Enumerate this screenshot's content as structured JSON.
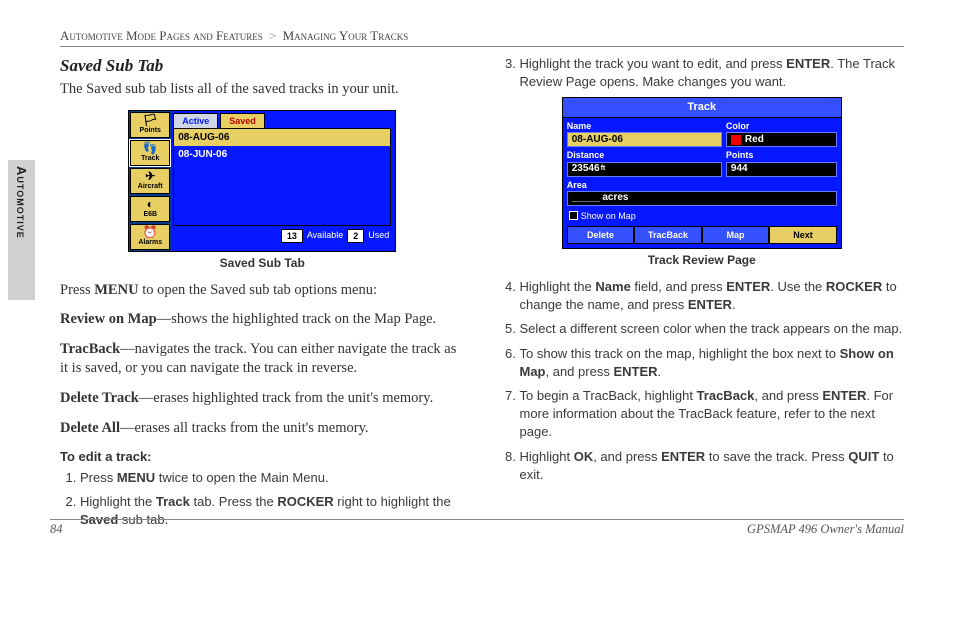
{
  "breadcrumb": {
    "section": "Automotive Mode Pages and Features",
    "sub": "Managing Your Tracks"
  },
  "side_tab": "Automotive",
  "left": {
    "heading": "Saved Sub Tab",
    "intro": "The Saved sub tab lists all of the saved tracks in your unit.",
    "figure_caption": "Saved Sub Tab",
    "after_fig": "Press MENU to open the Saved sub tab options menu:",
    "items": [
      {
        "term": "Review on Map",
        "desc": "—shows the highlighted track on the Map Page."
      },
      {
        "term": "TracBack",
        "desc": "—navigates the track. You can either navigate the track as it is saved, or you can navigate the track in reverse."
      },
      {
        "term": "Delete Track",
        "desc": "—erases highlighted track from the unit's memory."
      },
      {
        "term": "Delete All",
        "desc": "—erases all tracks from the unit's memory."
      }
    ],
    "proc_head": "To edit a track:",
    "steps": [
      "Press MENU twice to open the Main Menu.",
      "Highlight the Track tab. Press the ROCKER right to highlight the Saved sub tab."
    ]
  },
  "right": {
    "steps": [
      "Highlight the track you want to edit, and press ENTER. The Track Review Page opens. Make changes you want.",
      "Highlight the Name field, and press ENTER. Use the ROCKER to change the name, and press ENTER.",
      "Select a different screen color when the track appears on the map.",
      "To show this track on the map, highlight the box next to Show on Map, and press ENTER.",
      "To begin a TracBack, highlight TracBack, and press ENTER. For more information about the TracBack feature, refer to the next page.",
      "Highlight OK, and press ENTER to save the track. Press QUIT to exit."
    ],
    "figure_caption": "Track Review Page"
  },
  "shot1": {
    "side_items": [
      "Points",
      "Track",
      "Aircraft",
      "E6B",
      "Alarms"
    ],
    "tabs": [
      "Active",
      "Saved"
    ],
    "rows": [
      "08-AUG-06",
      "08-JUN-06"
    ],
    "selected_row": 0,
    "available_val": "13",
    "available_label": "Available",
    "used_val": "2",
    "used_label": "Used"
  },
  "shot2": {
    "title": "Track",
    "name_label": "Name",
    "name_val": "08-AUG-06",
    "color_label": "Color",
    "color_val": "Red",
    "distance_label": "Distance",
    "distance_val": "23546",
    "distance_unit": "ft",
    "points_label": "Points",
    "points_val": "944",
    "area_label": "Area",
    "area_val": "_____",
    "area_unit": "acres",
    "show_label": "Show on Map",
    "buttons": [
      "Delete",
      "TracBack",
      "Map",
      "Next"
    ],
    "selected_button": 3
  },
  "footer": {
    "page": "84",
    "manual": "GPSMAP 496 Owner's Manual"
  }
}
